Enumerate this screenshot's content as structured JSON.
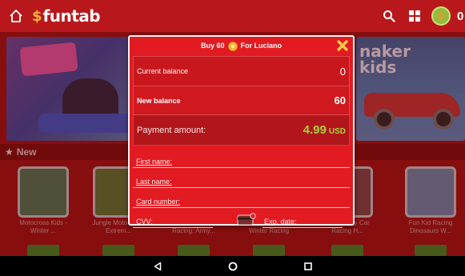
{
  "app": {
    "logo_mark": "$",
    "logo_text": "funtab"
  },
  "topbar": {
    "coins_partial": "0"
  },
  "banners": {
    "right_title": "naker\nkids"
  },
  "section_new": {
    "label": "New"
  },
  "games": [
    {
      "name": "Motocross Kids - Winter ..."
    },
    {
      "name": "Jungle Moto-cross Extrem..."
    },
    {
      "name": "Elite SWAT Car Racing: Army..."
    },
    {
      "name": "Monster Truck Winter Racing"
    },
    {
      "name": "Emergency Car Racing H..."
    },
    {
      "name": "Fun Kid Racing Dinosaurs W..."
    }
  ],
  "dialog": {
    "header_prefix": "Buy 60",
    "header_suffix": "For Luciano",
    "current_balance_label": "Current balance",
    "current_balance_value": "0",
    "new_balance_label": "New balance",
    "new_balance_value": "60",
    "payment_label": "Payment amount:",
    "payment_amount": "4.99",
    "payment_currency": "USD",
    "first_name_placeholder": "First name:",
    "last_name_placeholder": "Last name:",
    "card_number_placeholder": "Card number:",
    "cvv_placeholder": "CVV:",
    "exp_date_placeholder": "Exp. date:"
  },
  "colors": {
    "dialog_bg": "#e21b22",
    "amount_green": "#a8d23a",
    "topbar_red": "#b8181b"
  },
  "icons": {
    "home": "home-icon",
    "search": "search-icon",
    "grid": "grid-icon",
    "close": "close-icon",
    "coin": "coin-icon",
    "card": "credit-card-icon",
    "back": "back-icon",
    "home_nav": "home-circle-icon",
    "recents": "recents-icon"
  }
}
